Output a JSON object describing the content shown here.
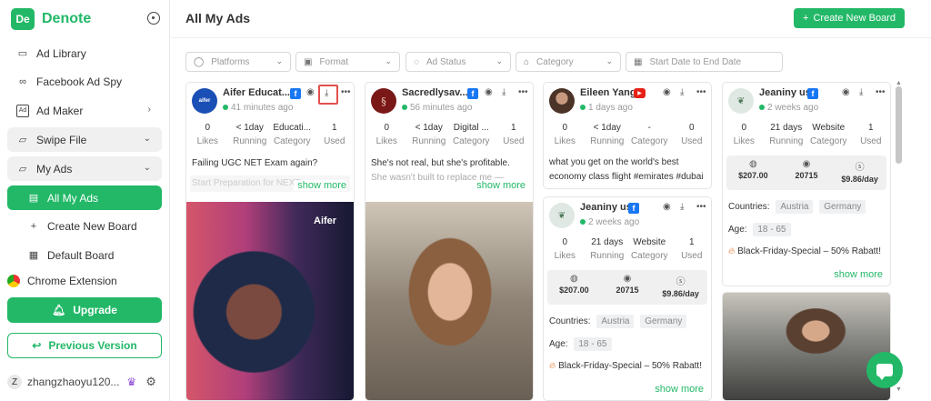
{
  "app": {
    "logo_mark": "De",
    "name": "Denote"
  },
  "sidebar": {
    "items": [
      {
        "label": "Ad Library",
        "icon": "library-icon"
      },
      {
        "label": "Facebook Ad Spy",
        "icon": "meta-icon"
      },
      {
        "label": "Ad Maker",
        "icon": "ad-icon"
      },
      {
        "label": "Swipe File",
        "icon": "folder-icon"
      },
      {
        "label": "My Ads",
        "icon": "folder-icon"
      },
      {
        "label": "All My Ads",
        "icon": "ads-icon"
      },
      {
        "label": "Create New Board",
        "icon": "plus-icon"
      },
      {
        "label": "Default Board",
        "icon": "grid-icon"
      },
      {
        "label": "Chrome Extension",
        "icon": "chrome-icon"
      }
    ],
    "upgrade_label": "Upgrade",
    "previous_label": "Previous Version",
    "user": {
      "initial": "Z",
      "name": "zhangzhaoyu120..."
    }
  },
  "header": {
    "title": "All My Ads",
    "create_label": "Create New Board"
  },
  "filters": {
    "platforms": "Platforms",
    "format": "Format",
    "ad_status": "Ad Status",
    "category": "Category",
    "date_placeholder": "Start Date to End Date"
  },
  "cards": {
    "aifer": {
      "name": "Aifer Educat...",
      "time": "41 minutes ago",
      "stats": [
        {
          "value": "0",
          "label": "Likes"
        },
        {
          "value": "< 1day",
          "label": "Running"
        },
        {
          "value": "Educati...",
          "label": "Category"
        },
        {
          "value": "1",
          "label": "Used"
        }
      ],
      "desc": "Failing UGC NET Exam again?",
      "desc_faded": "Start Preparation for NEXT...",
      "show_more": "show more",
      "image_logo": "Aifer"
    },
    "sacred": {
      "name": "Sacredlysav...",
      "time": "56 minutes ago",
      "stats": [
        {
          "value": "0",
          "label": "Likes"
        },
        {
          "value": "< 1day",
          "label": "Running"
        },
        {
          "value": "Digital ...",
          "label": "Category"
        },
        {
          "value": "1",
          "label": "Used"
        }
      ],
      "desc": "She's not real, but she's profitable.",
      "desc_faded": "She wasn't built to replace me —",
      "show_more": "show more"
    },
    "eileen": {
      "name": "Eileen Yang",
      "time": "1 days ago",
      "stats": [
        {
          "value": "0",
          "label": "Likes"
        },
        {
          "value": "< 1day",
          "label": "Running"
        },
        {
          "value": "-",
          "label": "Category"
        },
        {
          "value": "0",
          "label": "Used"
        }
      ],
      "desc": "what you get on the world's best economy class flight #emirates #dubai"
    },
    "jean1": {
      "name": "Jeaniny us",
      "time": "2 weeks ago",
      "stats": [
        {
          "value": "0",
          "label": "Likes"
        },
        {
          "value": "21 days",
          "label": "Running"
        },
        {
          "value": "Website",
          "label": "Category"
        },
        {
          "value": "1",
          "label": "Used"
        }
      ],
      "metrics": {
        "spend": "$207.00",
        "views": "20715",
        "per_day": "$9.86/day"
      },
      "countries_label": "Countries:",
      "countries": [
        "Austria",
        "Germany"
      ],
      "age_label": "Age:",
      "age": "18 - 65",
      "promo": "Black-Friday-Special – 50% Rabatt!",
      "show_more": "show more"
    },
    "jean2": {
      "name": "Jeaniny us",
      "time": "2 weeks ago",
      "stats": [
        {
          "value": "0",
          "label": "Likes"
        },
        {
          "value": "21 days",
          "label": "Running"
        },
        {
          "value": "Website",
          "label": "Category"
        },
        {
          "value": "1",
          "label": "Used"
        }
      ],
      "metrics": {
        "spend": "$207.00",
        "views": "20715",
        "per_day": "$9.86/day"
      },
      "countries_label": "Countries:",
      "countries": [
        "Austria",
        "Germany"
      ],
      "age_label": "Age:",
      "age": "18 - 65",
      "promo": "Black-Friday-Special – 50% Rabatt!",
      "show_more": "show more"
    }
  },
  "colors": {
    "brand": "#22b867",
    "highlight": "#e2504b",
    "facebook": "#1877f2",
    "youtube": "#e62117"
  }
}
